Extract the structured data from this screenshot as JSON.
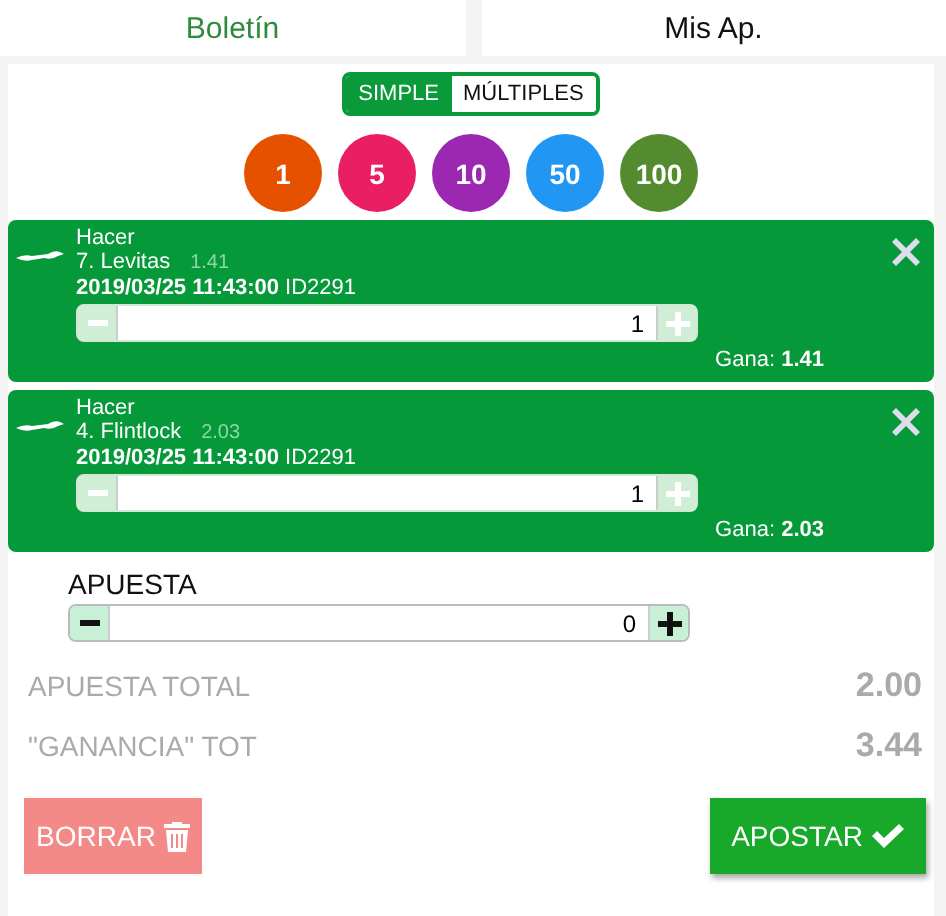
{
  "tabs": [
    {
      "label": "Boletín",
      "selected": true
    },
    {
      "label": "Mis Ap.",
      "selected": false
    }
  ],
  "mode_toggle": [
    {
      "label": "SIMPLE",
      "selected": true
    },
    {
      "label": "MÚLTIPLES",
      "selected": false
    }
  ],
  "chips": [
    {
      "label": "1",
      "color": "#e65100"
    },
    {
      "label": "5",
      "color": "#e91e63"
    },
    {
      "label": "10",
      "color": "#9c27b0"
    },
    {
      "label": "50",
      "color": "#2196f3"
    },
    {
      "label": "100",
      "color": "#558b2f"
    }
  ],
  "bets": [
    {
      "market": "Hacer",
      "runner": "7. Levitas",
      "odds": "1.41",
      "datetime": "2019/03/25 11:43:00",
      "event_id": "ID2291",
      "stake": "1",
      "win_label": "Gana:",
      "win_value": "1.41"
    },
    {
      "market": "Hacer",
      "runner": "4. Flintlock",
      "odds": "2.03",
      "datetime": "2019/03/25 11:43:00",
      "event_id": "ID2291",
      "stake": "1",
      "win_label": "Gana:",
      "win_value": "2.03"
    }
  ],
  "stake": {
    "label": "APUESTA",
    "value": "0"
  },
  "totals": [
    {
      "label": "APUESTA TOTAL",
      "value": "2.00"
    },
    {
      "label": "\"GANANCIA\" TOT",
      "value": "3.44"
    }
  ],
  "clear_button": {
    "label": "BORRAR",
    "disabled": true
  },
  "place_button": {
    "label": "APOSTAR",
    "disabled": false
  }
}
